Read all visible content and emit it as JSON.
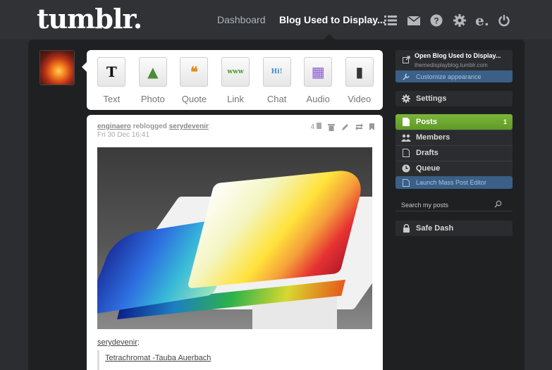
{
  "header": {
    "logo": "tumblr.",
    "nav_dashboard": "Dashboard",
    "nav_blog": "Blog Used to Display...",
    "icons": [
      "list-icon",
      "mail-icon",
      "help-icon",
      "gear-icon",
      "edit-icon",
      "power-icon"
    ]
  },
  "post_types": [
    {
      "label": "Text",
      "icon": "text-icon",
      "glyph": "T",
      "color": "#111111"
    },
    {
      "label": "Photo",
      "icon": "photo-icon",
      "glyph": "▲",
      "color": "#4a8c3a"
    },
    {
      "label": "Quote",
      "icon": "quote-icon",
      "glyph": "❝",
      "color": "#e8891a"
    },
    {
      "label": "Link",
      "icon": "link-icon",
      "glyph": "www",
      "color": "#4a9a2a"
    },
    {
      "label": "Chat",
      "icon": "chat-icon",
      "glyph": "Hi!",
      "color": "#3c8ad0"
    },
    {
      "label": "Audio",
      "icon": "audio-icon",
      "glyph": "▦",
      "color": "#8a5ad8"
    },
    {
      "label": "Video",
      "icon": "video-icon",
      "glyph": "▮",
      "color": "#333333"
    }
  ],
  "post": {
    "user": "enginaero",
    "action": " reblogged ",
    "source_user": "serydevenir",
    "colon": ":",
    "date": "Fri 30 Dec 16:41",
    "note_count": "4",
    "source_label": "serydevenir",
    "source_colon": ":",
    "quote_text": "Tetrachromat -Tauba Auerbach"
  },
  "sidebar": {
    "blog_title": "Open Blog Used to Display...",
    "blog_url": "themedisplayblog.tumblr.com",
    "customize": "Customize appearance",
    "settings": "Settings",
    "posts": "Posts",
    "posts_count": "1",
    "members": "Members",
    "drafts": "Drafts",
    "queue": "Queue",
    "mass_editor": "Launch Mass Post Editor",
    "search_placeholder": "Search my posts",
    "safe_dash": "Safe Dash"
  },
  "colors": {
    "background": "#2b2d30",
    "active_green": "#6aa72f",
    "blue_bar": "#3b5f87"
  }
}
